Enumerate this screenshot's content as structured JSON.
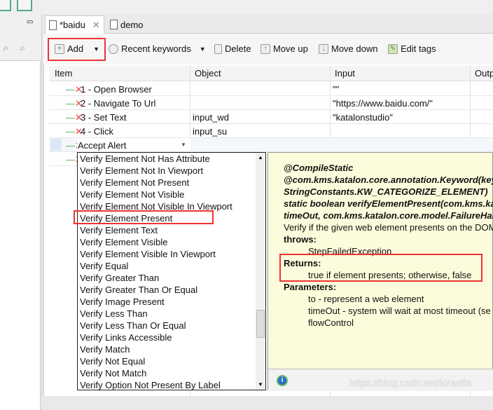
{
  "tabs": [
    {
      "label": "*baidu",
      "closable": true
    },
    {
      "label": "demo"
    }
  ],
  "toolbar": {
    "add": "Add",
    "recent": "Recent keywords",
    "delete": "Delete",
    "move_up": "Move up",
    "move_down": "Move down",
    "edit_tags": "Edit tags"
  },
  "table": {
    "columns": [
      "Item",
      "Object",
      "Input",
      "Outp"
    ],
    "rows": [
      {
        "item": "1 - Open Browser",
        "object": "",
        "input": "\"\""
      },
      {
        "item": "2 - Navigate To Url",
        "object": "",
        "input": "\"https://www.baidu.com/\""
      },
      {
        "item": "3 - Set Text",
        "object": "input_wd",
        "input": "\"katalonstudio\""
      },
      {
        "item": "4 - Click",
        "object": "input_su",
        "input": ""
      }
    ],
    "editing_value": "Accept Alert"
  },
  "dropdown": {
    "items": [
      "Verify Element Not Has Attribute",
      "Verify Element Not In Viewport",
      "Verify Element Not Present",
      "Verify Element Not Visible",
      "Verify Element Not Visible In Viewport",
      "Verify Element Present",
      "Verify Element Text",
      "Verify Element Visible",
      "Verify Element Visible In Viewport",
      "Verify Equal",
      "Verify Greater Than",
      "Verify Greater Than Or Equal",
      "Verify Image Present",
      "Verify Less Than",
      "Verify Less Than Or Equal",
      "Verify Links Accessible",
      "Verify Match",
      "Verify Not Equal",
      "Verify Not Match",
      "Verify Option Not Present By Label"
    ],
    "highlighted": "Verify Element Present"
  },
  "doc": {
    "sig": [
      "@CompileStatic",
      "@com.kms.katalon.core.annotation.Keyword(keyw",
      "StringConstants.KW_CATEGORIZE_ELEMENT)",
      "static boolean verifyElementPresent(com.kms.ka",
      "timeOut, com.kms.katalon.core.model.FailureHan"
    ],
    "desc": "Verify if the given web element presents on the DOM",
    "throws_label": "throws:",
    "throws": "StepFailedException",
    "returns_label": "Returns:",
    "returns": "true if element presents; otherwise, false",
    "params_label": "Parameters:",
    "params": [
      "to - represent a web element",
      "timeOut - system will wait at most timeout (se",
      "flowControl"
    ]
  },
  "watermark": "https://blog.csdn.net/kiraelfa",
  "colors": {
    "highlight_box": "#e33333",
    "doc_bg": "#fcfcdc"
  }
}
